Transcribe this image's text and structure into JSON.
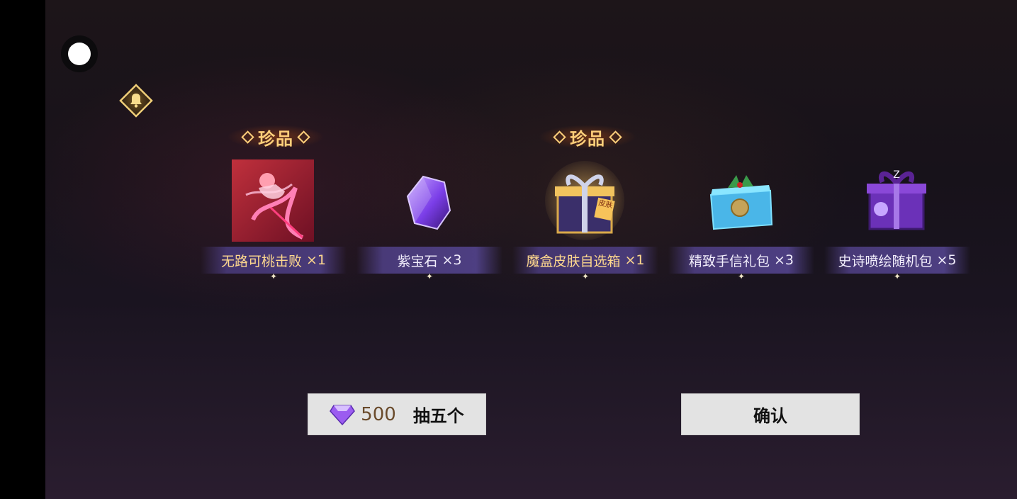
{
  "badges": {
    "rare_label": "珍品"
  },
  "rewards": [
    {
      "name": "无路可桃击败",
      "qty": "×1",
      "rare": true,
      "icon": "skin-effect-icon"
    },
    {
      "name": "紫宝石",
      "qty": "×3",
      "rare": false,
      "icon": "purple-gem-icon"
    },
    {
      "name": "魔盒皮肤自选箱",
      "qty": "×1",
      "rare": true,
      "icon": "skin-chest-icon",
      "icon_text": "皮肤"
    },
    {
      "name": "精致手信礼包",
      "qty": "×3",
      "rare": false,
      "icon": "blue-gift-icon"
    },
    {
      "name": "史诗喷绘随机包",
      "qty": "×5",
      "rare": false,
      "icon": "purple-gift-icon"
    }
  ],
  "buttons": {
    "draw": {
      "price": "500",
      "label": "抽五个",
      "icon": "purple-gem-icon"
    },
    "confirm": {
      "label": "确认"
    }
  },
  "colors": {
    "rare_gold": "#ffcf7a",
    "plate_purple": "#4b3c7d",
    "button_bg": "#e3e3e3"
  }
}
